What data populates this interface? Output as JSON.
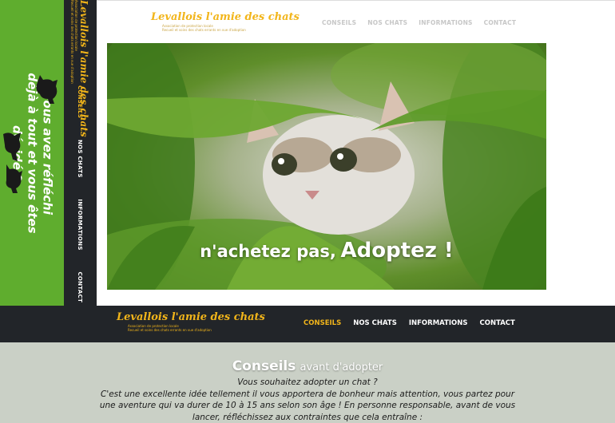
{
  "left_banner": {
    "lines": [
      "Vous avez réfléchi",
      "déjà à tout et vous êtes",
      "décidé ?"
    ],
    "background": "#5fad2e"
  },
  "brand": {
    "name": "Levallois l'amie des chats",
    "subtitle_1": "Association de protection locale",
    "subtitle_2": "Recueil et soins des chats errants en vue d'adoption",
    "accent_color": "#f2b51a"
  },
  "side_nav": {
    "items": [
      {
        "label": "CONSEILS",
        "active": true
      },
      {
        "label": "NOS CHATS",
        "active": false
      },
      {
        "label": "INFORMATIONS",
        "active": false
      },
      {
        "label": "CONTACT",
        "active": false
      }
    ]
  },
  "top_nav": {
    "items": [
      {
        "label": "CONSEILS"
      },
      {
        "label": "NOS CHATS"
      },
      {
        "label": "INFORMATIONS"
      },
      {
        "label": "CONTACT"
      }
    ]
  },
  "hero": {
    "caption_small": "n'achetez pas,",
    "caption_big": "Adoptez !"
  },
  "main_nav": {
    "items": [
      {
        "label": "CONSEILS",
        "active": true
      },
      {
        "label": "NOS CHATS",
        "active": false
      },
      {
        "label": "INFORMATIONS",
        "active": false
      },
      {
        "label": "CONTACT",
        "active": false
      }
    ],
    "background": "#222529"
  },
  "content": {
    "title_main": "Conseils",
    "title_rest": "avant d'adopter",
    "paragraphs": [
      "Vous souhaitez adopter un chat ?",
      "C'est une excellente idée tellement il vous apportera de bonheur mais attention, vous partez pour",
      "une aventure qui va durer de 10 à 15 ans selon son âge ! En personne responsable, avant de vous",
      "lancer, réfléchissez aux contraintes que cela entraîne :"
    ],
    "background": "#cad0c6"
  }
}
